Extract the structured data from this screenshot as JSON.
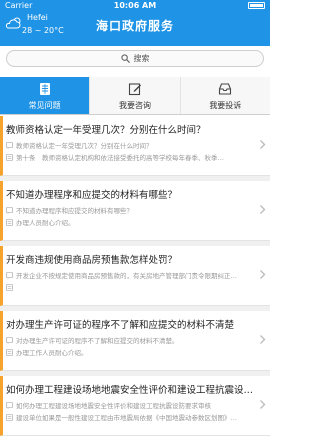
{
  "status_bar": {
    "carrier": "Carrier",
    "time": "10:06 AM"
  },
  "weather": {
    "city": "Hefei",
    "temperature": "28 ~ 20°C",
    "icon": "cloud-sun-icon"
  },
  "header": {
    "title": "海口政府服务"
  },
  "search": {
    "placeholder": "搜索",
    "icon": "search-icon"
  },
  "tabs": [
    {
      "label": "常见问题",
      "icon": "document-list-icon",
      "active": true
    },
    {
      "label": "我要咨询",
      "icon": "edit-icon",
      "active": false
    },
    {
      "label": "我要投诉",
      "icon": "inbox-icon",
      "active": false
    }
  ],
  "questions": [
    {
      "title": "教师资格认定一年受理几次？分别在什么时间？",
      "line1": "教师资格认定一年受理几次？分别在什么时间？",
      "line2": "第十条　教师资格认定机构和依法接受委托的高等学校每年春季、秋季…"
    },
    {
      "title": "不知道办理程序和应提交的材料有哪些？",
      "line1": "不知道办理程序和应提交的材料有哪些？",
      "line2": "办理人员耐心介绍。"
    },
    {
      "title": "开发商违规使用商品房预售款怎样处罚？",
      "line1": "开发企业不按规定使用商品房预售款的，有关房地产管理部门责令限期纠正…",
      "line2": ""
    },
    {
      "title": "对办理生产许可证的程序不了解和应提交的材料不清楚",
      "line1": "对办理生产许可证的程序不了解和应提交的材料不清楚。",
      "line2": "办理工作人员耐心介绍。"
    },
    {
      "title": "如何办理工程建设场地地震安全性评价和建设工程抗震设防要求审核",
      "line1": "如何办理工程建设场地地震安全性评价和建设工程抗震设防要求审核",
      "line2": "建设单位如果是一般性建设工程由市地震局依据《中国地震动参数区划图》…"
    }
  ]
}
